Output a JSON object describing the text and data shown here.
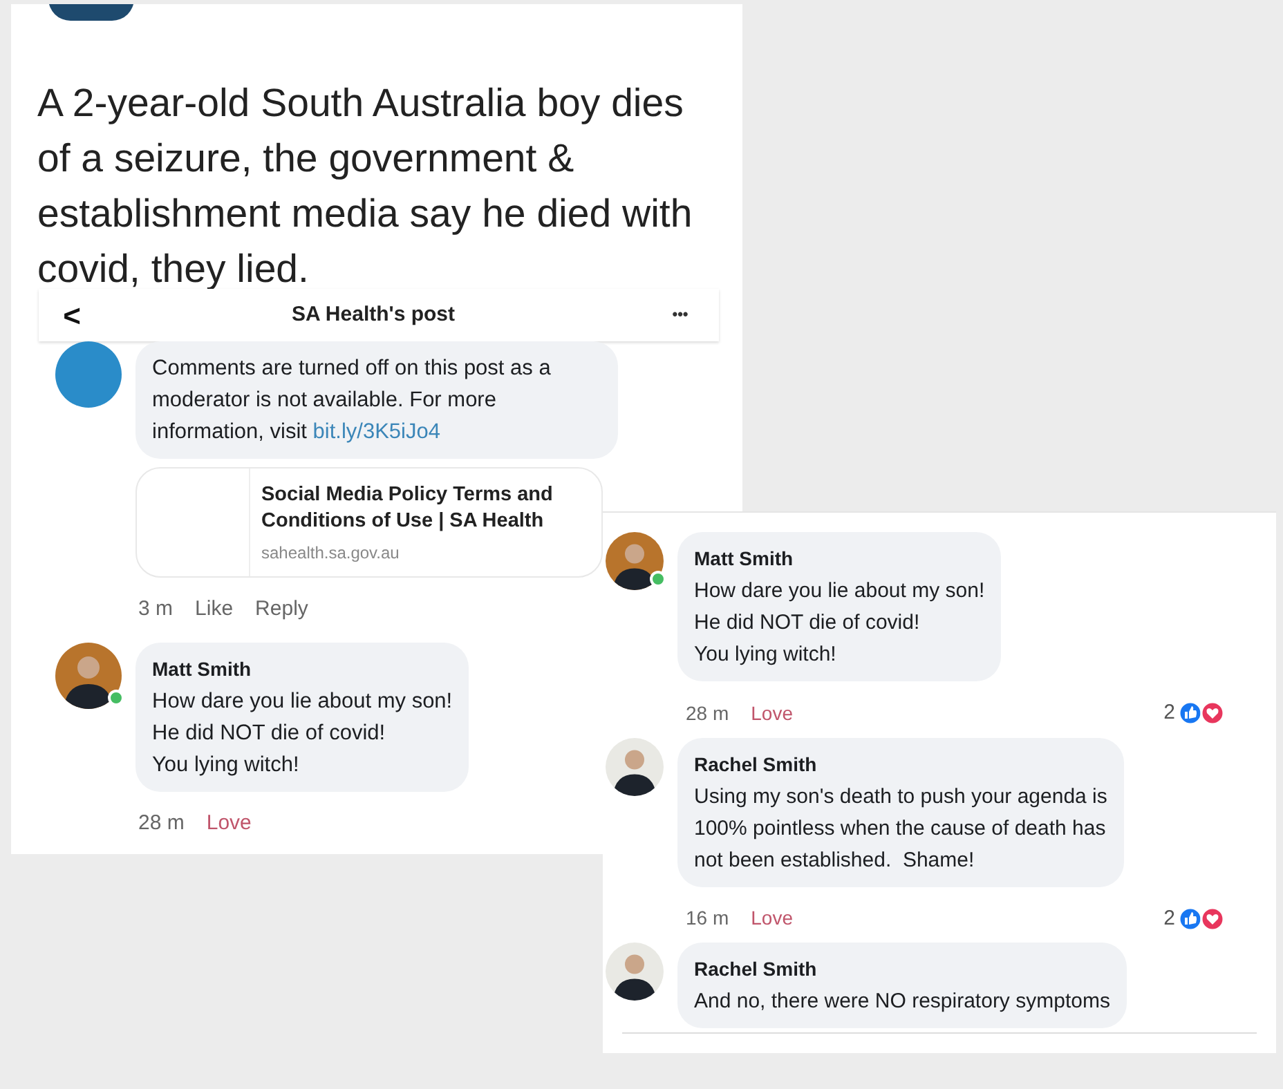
{
  "headline": "A 2-year-old South Australia boy dies of a seizure, the government & establishment media say he died with covid, they lied.",
  "post_header": {
    "back": "<",
    "title": "SA Health's post",
    "more": "•••"
  },
  "left_comments": [
    {
      "kind": "page",
      "text_parts": [
        {
          "text": "Comments are turned off on this post as a moderator is not available. For more information, visit ",
          "link": false
        },
        {
          "text": "bit.ly/3K5iJo4",
          "link": true
        }
      ],
      "link_preview": {
        "title": "Social Media Policy Terms and Conditions of Use | SA Health",
        "domain": "sahealth.sa.gov.au"
      },
      "time": "3 m",
      "actions": [
        {
          "label": "Like",
          "active": false
        },
        {
          "label": "Reply",
          "active": false
        }
      ]
    },
    {
      "kind": "person",
      "author": "Matt Smith",
      "online": true,
      "lines": [
        "How dare you lie about my son!",
        "He did NOT die of covid!",
        "You lying witch!"
      ],
      "time": "28 m",
      "actions": [
        {
          "label": "Love",
          "active": true
        }
      ]
    }
  ],
  "right_comments": [
    {
      "kind": "person",
      "author": "Matt Smith",
      "online": true,
      "lines": [
        "How dare you lie about my son!",
        "He did NOT die of covid!",
        "You lying witch!"
      ],
      "time": "28 m",
      "actions": [
        {
          "label": "Love",
          "active": true
        }
      ],
      "reaction_count": "2"
    },
    {
      "kind": "person",
      "author": "Rachel Smith",
      "online": false,
      "lines": [
        "Using my son's death to push your agenda is",
        "100% pointless when the cause of death has",
        "not been established.  Shame!"
      ],
      "time": "16 m",
      "actions": [
        {
          "label": "Love",
          "active": true
        }
      ],
      "reaction_count": "2"
    },
    {
      "kind": "person",
      "author": "Rachel Smith",
      "online": false,
      "lines": [
        "And no, there were NO respiratory symptoms"
      ]
    }
  ]
}
